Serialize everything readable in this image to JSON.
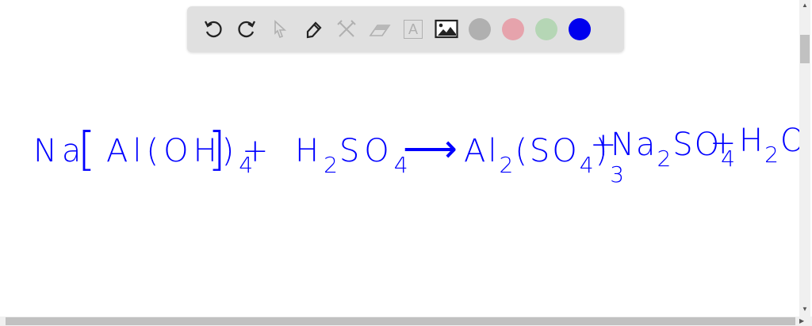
{
  "toolbar": {
    "tools": [
      {
        "icon": "undo-icon"
      },
      {
        "icon": "redo-icon"
      },
      {
        "icon": "select-arrow-icon"
      },
      {
        "icon": "pen-icon"
      },
      {
        "icon": "tools-icon"
      },
      {
        "icon": "eraser-icon"
      },
      {
        "icon": "text-icon",
        "label": "A"
      },
      {
        "icon": "image-icon"
      }
    ],
    "colors": [
      "#b0b0b0",
      "#e6a3ac",
      "#b5d6b5",
      "#0000ee"
    ]
  },
  "equation": {
    "na": "Na",
    "lbracket": "[",
    "aloh": "Al(OH)",
    "aloh_sub": "4",
    "rbracket": "]",
    "plus1": "+",
    "h": "H",
    "h_sub": "2",
    "so": "SO",
    "so_sub": "4",
    "arrow": "⟶",
    "al": "Al",
    "al_sub": "2",
    "so4": "(SO",
    "so4_sub": "4",
    "paren": ")",
    "paren_sub": "3",
    "plus2": "+",
    "na2": "Na",
    "na2_sub": "2",
    "na2so": "SO",
    "na2so_sub": "4",
    "plus3": "+",
    "h2": "H",
    "h2_sub": "2",
    "o": "O"
  }
}
